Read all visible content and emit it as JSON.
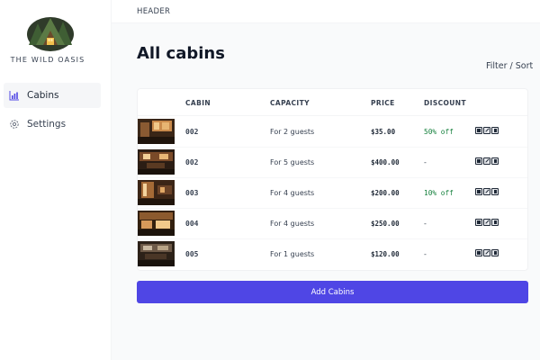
{
  "sidebar": {
    "logo_text": "THE WILD OASIS",
    "items": [
      {
        "label": "Cabins",
        "icon": "chart-icon",
        "active": true
      },
      {
        "label": "Settings",
        "icon": "gear-icon",
        "active": false
      }
    ]
  },
  "header": {
    "text": "HEADER"
  },
  "main": {
    "title": "All cabins",
    "filter_sort": "Filter / Sort",
    "table": {
      "columns": [
        "",
        "CABIN",
        "CAPACITY",
        "PRICE",
        "DISCOUNT",
        ""
      ],
      "rows": [
        {
          "cabin": "002",
          "capacity": "For 2 guests",
          "price": "$35.00",
          "discount": "50% off"
        },
        {
          "cabin": "002",
          "capacity": "For 5 guests",
          "price": "$400.00",
          "discount": "-"
        },
        {
          "cabin": "003",
          "capacity": "For 4 guests",
          "price": "$200.00",
          "discount": "10% off"
        },
        {
          "cabin": "004",
          "capacity": "For 4 guests",
          "price": "$250.00",
          "discount": "-"
        },
        {
          "cabin": "005",
          "capacity": "For 1 guests",
          "price": "$120.00",
          "discount": "-"
        }
      ]
    },
    "add_button": "Add Cabins"
  },
  "colors": {
    "accent": "#4f46e5",
    "discount": "#15803d",
    "background": "#f9fafb"
  }
}
